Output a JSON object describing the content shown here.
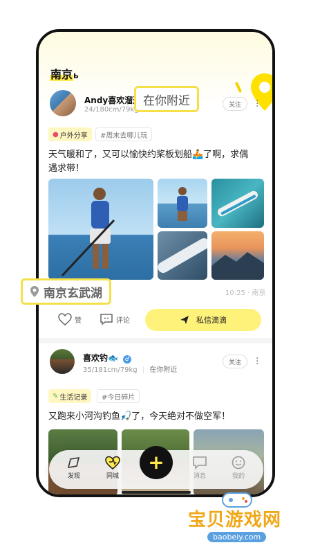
{
  "header": {
    "city": "南京"
  },
  "callouts": {
    "nearby": "在你附近",
    "location": "南京玄武湖"
  },
  "posts": [
    {
      "user_name": "Andy喜欢溜达",
      "user_meta": "24/180cm/79kg",
      "follow_label": "关注",
      "category_tag": "户外分享",
      "topic_tag": "#周末去哪儿玩",
      "text": "天气暖和了，又可以愉快约桨板划船🚣了啊，求偶遇求带！",
      "time_location": "10:25 · 南京",
      "like_label": "赞",
      "comment_label": "评论",
      "dm_label": "私信滴滴"
    },
    {
      "user_name": "喜欢钓🐟",
      "user_meta": "35/181cm/79kg",
      "distance": "在你附近",
      "follow_label": "关注",
      "category_tag": "生活记录",
      "topic_tag": "#今日碎片",
      "text": "又跑来小河沟钓鱼🎣了，今天绝对不做空军！"
    }
  ],
  "tabbar": {
    "items": [
      {
        "label": "发现",
        "icon": "discover-icon"
      },
      {
        "label": "同城",
        "icon": "heart-location-icon"
      },
      {
        "label": "消息",
        "icon": "message-icon"
      },
      {
        "label": "我的",
        "icon": "smile-icon"
      }
    ]
  },
  "watermark": {
    "brand": "宝贝游戏网",
    "url": "baobeiy.com"
  },
  "colors": {
    "accent": "#ffe94d",
    "button": "#fff27a",
    "fab": "#111111"
  }
}
